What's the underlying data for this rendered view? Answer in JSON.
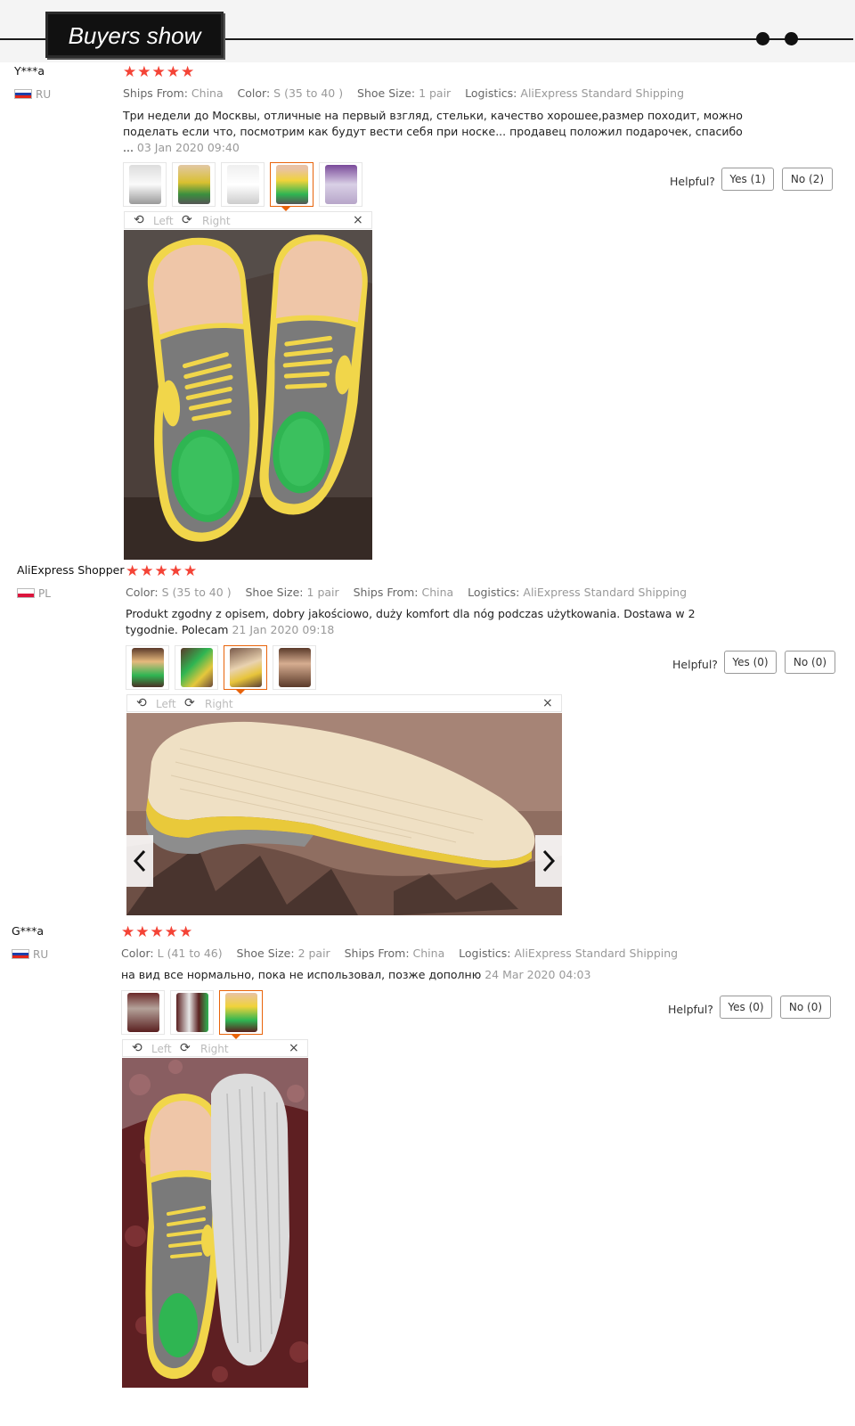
{
  "header": {
    "title": "Buyers show"
  },
  "reviews": [
    {
      "user": "Y***a",
      "country": "RU",
      "stars": "★★★★★",
      "meta": [
        {
          "label": "Ships From:",
          "value": "China"
        },
        {
          "label": "Color:",
          "value": "S (35 to 40 )"
        },
        {
          "label": "Shoe Size:",
          "value": "1 pair"
        },
        {
          "label": "Logistics:",
          "value": "AliExpress Standard Shipping"
        }
      ],
      "text": "Три недели до Москвы, отличные на первый взгляд, стельки, качество хорошее,размер походит, можно поделать если что, посмотрим как будут вести себя при носке... продавец положил подарочек, спасибо ... ",
      "date": "03 Jan 2020 09:40",
      "helpful_label": "Helpful?",
      "yes_label": "Yes (1)",
      "no_label": "No (2)",
      "viewer": {
        "left": "Left",
        "right": "Right",
        "close": "×"
      }
    },
    {
      "user": "AliExpress Shopper",
      "country": "PL",
      "stars": "★★★★★",
      "meta": [
        {
          "label": "Color:",
          "value": "S (35 to 40 )"
        },
        {
          "label": "Shoe Size:",
          "value": "1 pair"
        },
        {
          "label": "Ships From:",
          "value": "China"
        },
        {
          "label": "Logistics:",
          "value": "AliExpress Standard Shipping"
        }
      ],
      "text": "Produkt zgodny z opisem, dobry jakościowo, duży komfort dla nóg podczas użytkowania. Dostawa w 2 tygodnie. Polecam ",
      "date": "21 Jan 2020 09:18",
      "helpful_label": "Helpful?",
      "yes_label": "Yes (0)",
      "no_label": "No (0)",
      "viewer": {
        "left": "Left",
        "right": "Right",
        "close": "×"
      }
    },
    {
      "user": "G***a",
      "country": "RU",
      "stars": "★★★★★",
      "meta": [
        {
          "label": "Color:",
          "value": "L (41 to 46)"
        },
        {
          "label": "Shoe Size:",
          "value": "2 pair"
        },
        {
          "label": "Ships From:",
          "value": "China"
        },
        {
          "label": "Logistics:",
          "value": "AliExpress Standard Shipping"
        }
      ],
      "text": "на вид все нормально, пока не использовал, позже дополню ",
      "date": "24 Mar 2020 04:03",
      "helpful_label": "Helpful?",
      "yes_label": "Yes (0)",
      "no_label": "No (0)",
      "viewer": {
        "left": "Left",
        "right": "Right",
        "close": "×"
      }
    }
  ],
  "colors": {
    "star": "#f44336",
    "active_thumb": "#e8630a",
    "insole_yellow": "#f2d73a",
    "insole_gray": "#7b7b7b",
    "gel_green": "#2fb552"
  }
}
